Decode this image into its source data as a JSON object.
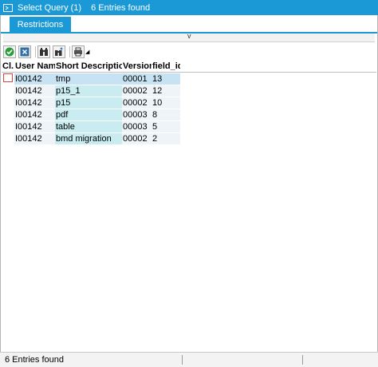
{
  "window": {
    "title": "Select Query (1)",
    "count": "6 Entries found"
  },
  "tabs": [
    {
      "label": "Restrictions"
    }
  ],
  "collapse": {
    "arrow": "v"
  },
  "table": {
    "headers": [
      "Cl.",
      "User Name",
      "Short Description",
      "Version",
      "field_id"
    ],
    "rows": [
      [
        "",
        "I00142",
        "tmp",
        "00001",
        "13"
      ],
      [
        "",
        "I00142",
        "p15_1",
        "00002",
        "12"
      ],
      [
        "",
        "I00142",
        "p15",
        "00002",
        "10"
      ],
      [
        "",
        "I00142",
        "pdf",
        "00003",
        "8"
      ],
      [
        "",
        "I00142",
        "table",
        "00003",
        "5"
      ],
      [
        "",
        "I00142",
        "bmd migration",
        "00002",
        "2"
      ]
    ]
  },
  "status": {
    "text": "6 Entries found"
  },
  "colors": {
    "accent": "#1a99d6",
    "row_desc": "#c8ecf0",
    "selection": "#c7e3f3"
  }
}
